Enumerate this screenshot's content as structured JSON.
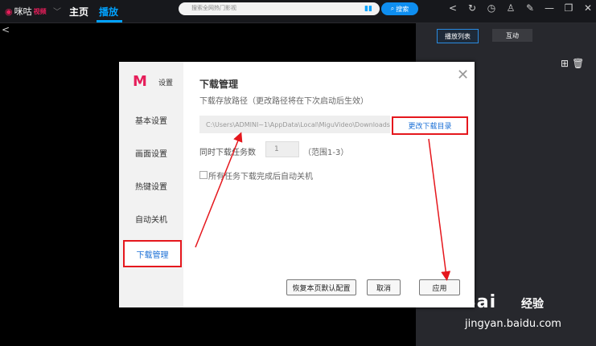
{
  "topbar": {
    "logo_text": "咪咕",
    "logo_sub": "视频",
    "nav_home": "主页",
    "nav_play": "播放",
    "search_placeholder": "搜索全网热门影视",
    "search_button": "搜索"
  },
  "right_panel": {
    "tab_playlist": "播放列表",
    "tab_interact": "互动"
  },
  "dialog": {
    "settings_label": "设置",
    "sidebar": {
      "items": [
        {
          "label": "基本设置"
        },
        {
          "label": "画面设置"
        },
        {
          "label": "热键设置"
        },
        {
          "label": "自动关机"
        },
        {
          "label": "下载管理"
        }
      ]
    },
    "title": "下载管理",
    "subtitle": "下载存放路径（更改路径将在下次启动后生效）",
    "path_value": "C:\\Users\\ADMINI~1\\AppData\\Local\\MiguVideo\\Downloads\\",
    "change_dir_label": "更改下载目录",
    "concurrent_label": "同时下载任务数",
    "concurrent_value": "1",
    "concurrent_range": "（范围1-3）",
    "auto_shutdown_label": "所有任务下载完成后自动关机",
    "restore_label": "恢复本页默认配置",
    "cancel_label": "取消",
    "apply_label": "应用"
  },
  "watermark": {
    "brand": "Bai",
    "text": "经验",
    "url": "jingyan.baidu.com"
  },
  "colors": {
    "accent": "#00a2ff",
    "highlight": "#e5171d",
    "link": "#1a6fd6",
    "brand": "#e61e5a"
  }
}
